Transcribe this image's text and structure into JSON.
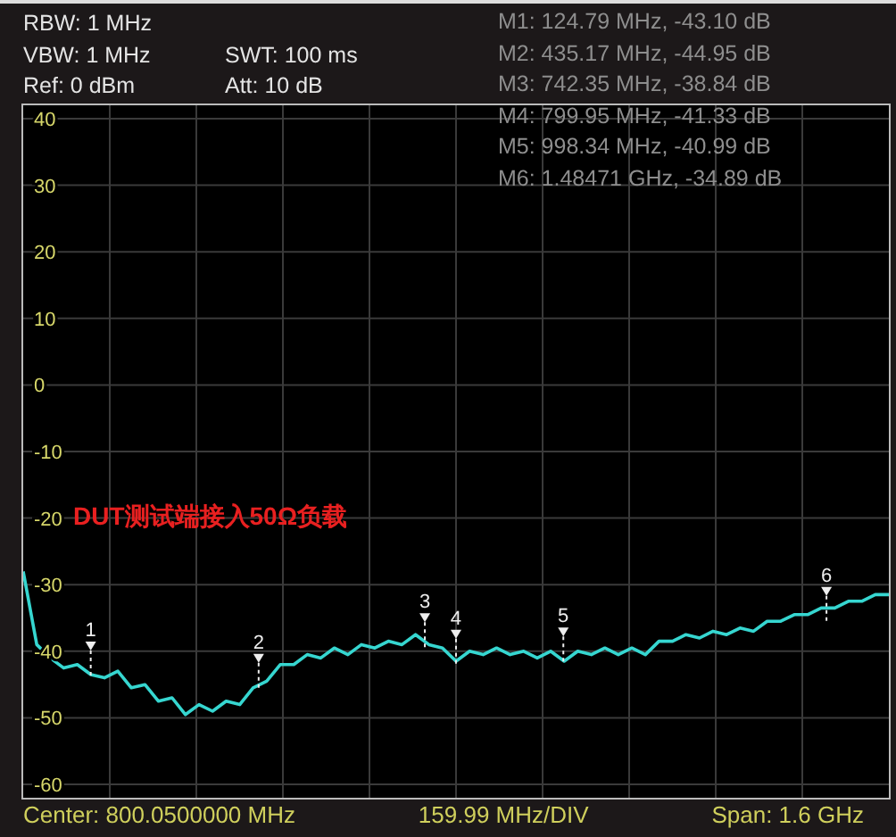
{
  "settings": [
    [
      "RBW: 1 MHz"
    ],
    [
      "VBW: 1 MHz",
      "SWT: 100 ms"
    ],
    [
      "Ref: 0 dBm",
      "Att: 10 dB"
    ]
  ],
  "marker_readouts": [
    "M1: 124.79 MHz, -43.10 dB",
    "M2: 435.17 MHz, -44.95 dB",
    "M3: 742.35 MHz, -38.84 dB",
    "M4: 799.95 MHz, -41.33 dB",
    "M5: 998.34 MHz, -40.99 dB",
    "M6: 1.48471 GHz, -34.89 dB"
  ],
  "plot": {
    "marker_numbers": [
      "1",
      "2",
      "3",
      "4",
      "5",
      "6"
    ],
    "overlay_note": "DUT测试端接入50Ω负载",
    "chart_data": {
      "type": "line",
      "grid": true,
      "ylim": [
        -62,
        42
      ],
      "yticks": [
        40,
        30,
        20,
        10,
        0,
        -10,
        -20,
        -30,
        -40,
        -50,
        -60
      ],
      "categories": [
        null,
        null,
        null,
        null,
        null,
        null,
        null,
        null,
        null,
        null,
        null,
        null,
        null,
        null,
        null,
        null,
        null,
        null,
        null,
        null,
        null,
        null,
        null,
        null,
        null,
        null,
        null,
        null,
        null,
        null,
        null,
        null,
        null,
        null,
        null,
        null,
        null,
        null,
        null,
        null,
        null,
        null,
        null,
        null,
        null,
        null,
        null,
        null,
        null,
        null,
        null,
        null,
        null,
        null,
        null,
        null,
        null,
        null,
        null,
        null,
        null,
        null,
        null,
        null,
        null
      ],
      "series": [
        {
          "color": "#36d6d0",
          "values": [
            -28,
            -39,
            -41,
            -42.5,
            -42,
            -43.5,
            -44,
            -43,
            -45.5,
            -45,
            -47.5,
            -47,
            -49.5,
            -48,
            -49,
            -47.5,
            -48,
            -45.5,
            -44.5,
            -42,
            -42,
            -40.5,
            -41,
            -39.5,
            -40.5,
            -39,
            -39.5,
            -38.5,
            -39,
            -37.5,
            -39,
            -39.5,
            -41.5,
            -40,
            -40.5,
            -39.5,
            -40.5,
            -40,
            -41,
            -40,
            -41.5,
            -40,
            -40.5,
            -39.5,
            -40.5,
            -39.5,
            -40.5,
            -38.5,
            -38.5,
            -37.5,
            -38,
            -37,
            -37.5,
            -36.5,
            -37,
            -35.5,
            -35.5,
            -34.5,
            -34.5,
            -33.5,
            -33.5,
            -32.5,
            -32.5,
            -31.5,
            -31.5
          ]
        }
      ]
    }
  },
  "footer": {
    "center": "Center: 800.0500000 MHz",
    "scale": "159.99 MHz/DIV",
    "span": "Span: 1.6 GHz"
  }
}
